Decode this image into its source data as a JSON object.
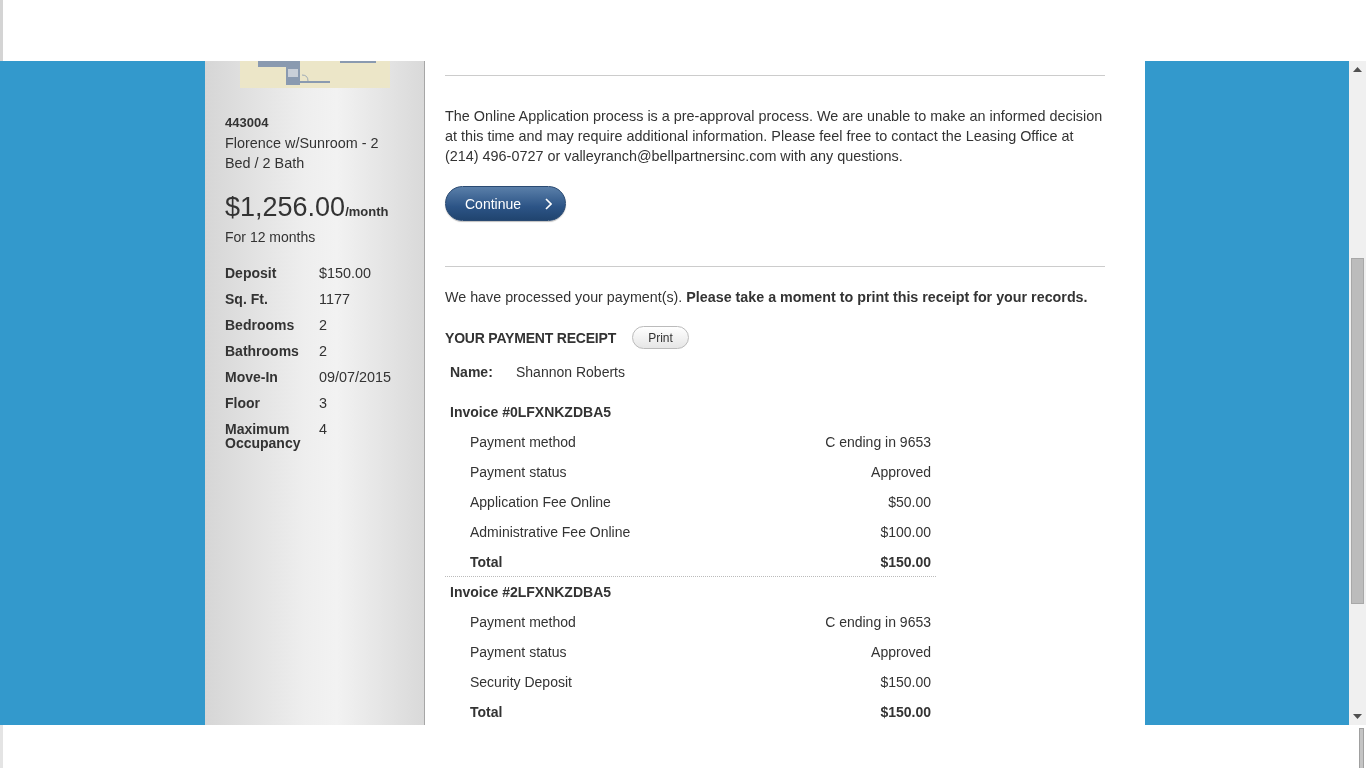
{
  "sidebar": {
    "unit_number": "443004",
    "unit_name": "Florence w/Sunroom - 2 Bed / 2 Bath",
    "price": "$1,256.00",
    "price_unit": "/month",
    "term": "For 12 months",
    "specs": [
      {
        "label": "Deposit",
        "value": "$150.00"
      },
      {
        "label": "Sq. Ft.",
        "value": "1177"
      },
      {
        "label": "Bedrooms",
        "value": "2"
      },
      {
        "label": "Bathrooms",
        "value": "2"
      },
      {
        "label": "Move-In",
        "value": "09/07/2015"
      },
      {
        "label": "Floor",
        "value": "3"
      },
      {
        "label": "Maximum Occupancy",
        "value": "4"
      }
    ]
  },
  "content": {
    "notice": "The Online Application process is a pre-approval process. We are unable to make an informed decision at this time and may require additional information. Please feel free to contact the Leasing Office at (214) 496-0727 or valleyranch@bellpartnersinc.com with any questions.",
    "continue_button": "Continue",
    "processed_message": "We have processed your payment(s). **Please take a moment to print this receipt for your records.**",
    "receipt": {
      "title": "YOUR PAYMENT RECEIPT",
      "print_button": "Print",
      "name_label": "Name:",
      "name": "Shannon Roberts",
      "invoices": [
        {
          "title": "Invoice #0LFXNKZDBA5",
          "lines": [
            {
              "label": "Payment method",
              "value": "C ending in 9653"
            },
            {
              "label": "Payment status",
              "value": "Approved"
            },
            {
              "label": "Application Fee Online",
              "value": "$50.00"
            },
            {
              "label": "Administrative Fee Online",
              "value": "$100.00"
            }
          ],
          "total": {
            "label": "Total",
            "value": "$150.00"
          }
        },
        {
          "title": "Invoice #2LFXNKZDBA5",
          "lines": [
            {
              "label": "Payment method",
              "value": "C ending in 9653"
            },
            {
              "label": "Payment status",
              "value": "Approved"
            },
            {
              "label": "Security Deposit",
              "value": "$150.00"
            }
          ],
          "total": {
            "label": "Total",
            "value": "$150.00"
          }
        }
      ]
    }
  }
}
